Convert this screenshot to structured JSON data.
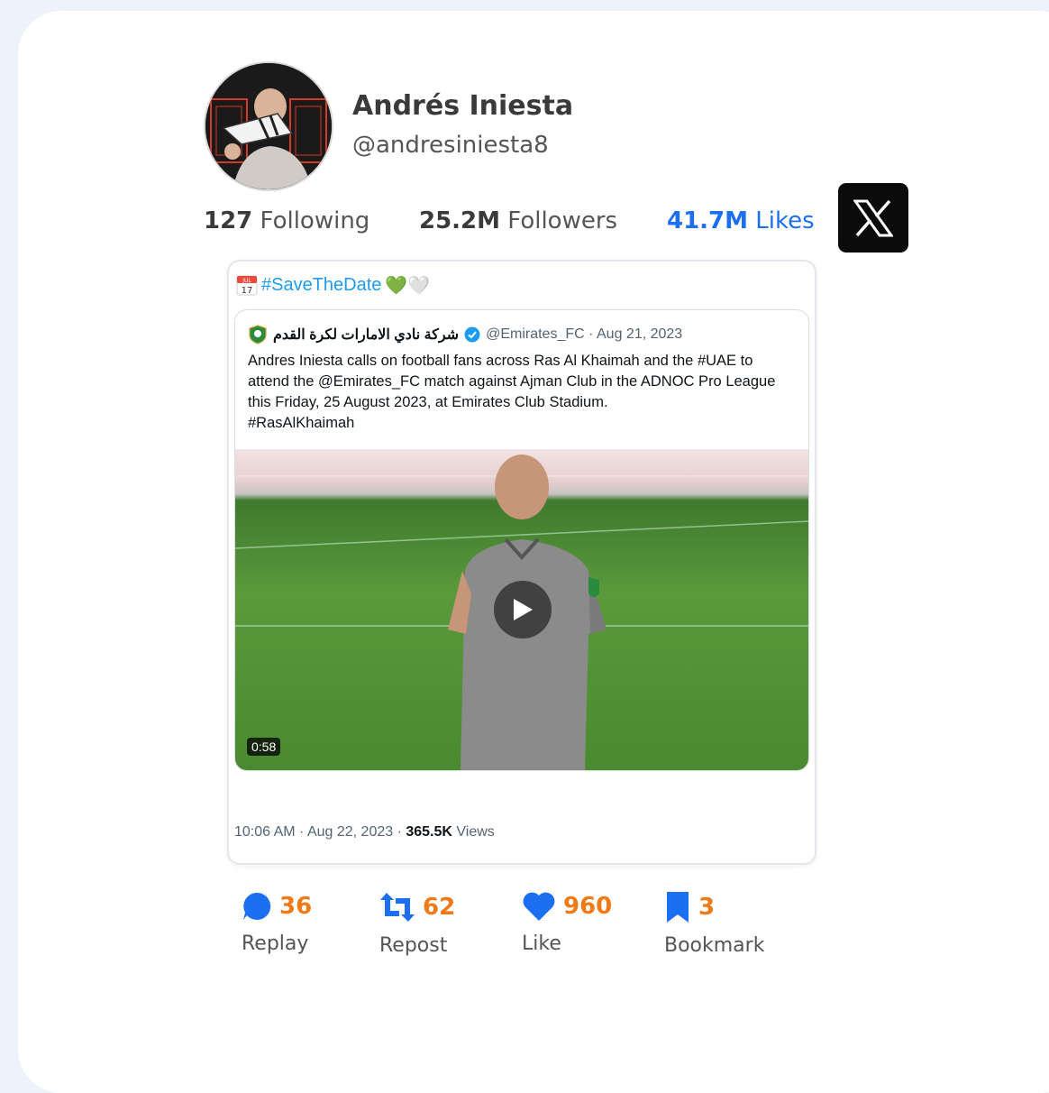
{
  "profile": {
    "name": "Andrés Iniesta",
    "handle": "@andresiniesta8"
  },
  "stats": {
    "following_count": "127",
    "following_label": "Following",
    "followers_count": "25.2M",
    "followers_label": "Followers",
    "likes_count": "41.7M",
    "likes_label": "Likes"
  },
  "tweet": {
    "calendar_month": "JUL",
    "calendar_day": "17",
    "hashtag": "#SaveTheDate",
    "emojis": "💚🤍",
    "quote": {
      "author_ar": "شركة نادي الامارات لكرة القدم",
      "handle_date": "@Emirates_FC · Aug 21, 2023",
      "text_lines": [
        "Andres Iniesta calls on football fans across Ras Al Khaimah and the #UAE to",
        "attend the @Emirates_FC match against Ajman Club in the ADNOC Pro League",
        "this Friday, 25 August 2023, at Emirates Club Stadium.",
        "#RasAlKhaimah"
      ],
      "video_duration": "0:58"
    },
    "meta_time": "10:06 AM · Aug 22, 2023 · ",
    "meta_views_count": "365.5K",
    "meta_views_label": " Views"
  },
  "actions": {
    "reply_count": "36",
    "reply_label": "Replay",
    "repost_count": "62",
    "repost_label": "Repost",
    "like_count": "960",
    "like_label": "Like",
    "bookmark_count": "3",
    "bookmark_label": "Bookmark"
  },
  "colors": {
    "accent_blue": "#1d6ff2",
    "count_orange": "#f07a17",
    "background": "#eef2fb"
  },
  "icons": [
    "verified-badge-icon",
    "x-logo-icon",
    "play-icon",
    "reply-icon",
    "repost-icon",
    "heart-icon",
    "bookmark-icon",
    "calendar-icon"
  ]
}
